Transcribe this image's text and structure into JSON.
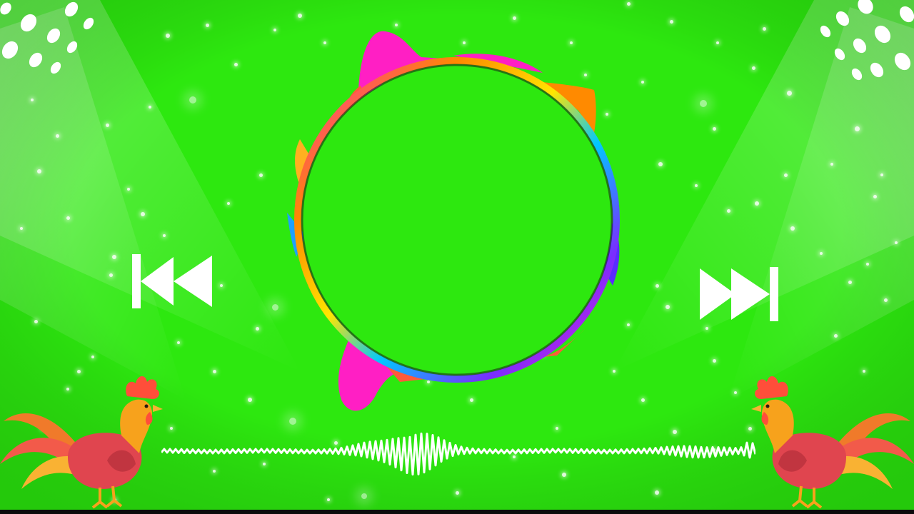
{
  "colors": {
    "background": "#2de80f",
    "light": "#ffffff",
    "ring_gradient": [
      "#ff1fc4",
      "#ff8a00",
      "#ffe600",
      "#00c8ff",
      "#7a2cff",
      "#ff1fc4"
    ],
    "rooster_body": "#e0454f",
    "rooster_neck": "#f7a21c",
    "rooster_comb": "#ff4e3a",
    "rooster_tail": [
      "#f07a2a",
      "#f25a4a",
      "#f9b233"
    ]
  },
  "controls": {
    "previous": "rewind-icon",
    "next": "fast-forward-icon"
  },
  "decorations": {
    "spotlights": "spotlight-icon",
    "waveform": "sound-wave",
    "visualizer": "circular-audio-visualizer",
    "mascots": "rooster-icon"
  }
}
